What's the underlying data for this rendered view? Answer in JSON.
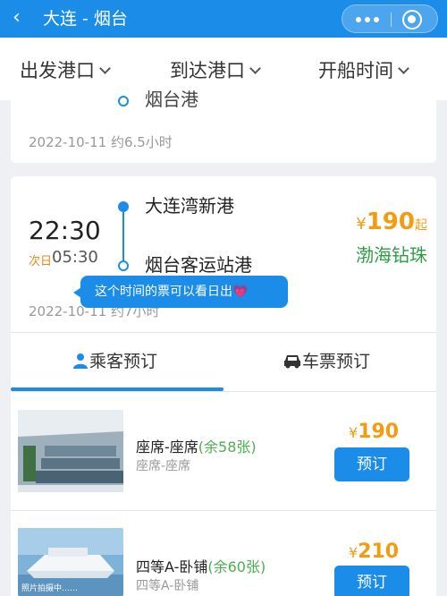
{
  "nav": {
    "back_icon": "‹",
    "title": "大连 - 烟台"
  },
  "filters": [
    {
      "label": "出发港口"
    },
    {
      "label": "到达港口"
    },
    {
      "label": "开船时间"
    }
  ],
  "card_prev": {
    "arrival_station": "烟台港",
    "date_duration": "2022-10-11 约6.5小时"
  },
  "card_main": {
    "depart_time": "22:30",
    "arrive_flag": "次日",
    "arrive_time": "05:30",
    "depart_station": "大连湾新港",
    "arrive_station": "烟台客运站港",
    "price_currency": "¥",
    "price": "190",
    "price_suffix": "起",
    "ship_name": "渤海钻珠",
    "date_duration": "2022-10-11 约7小时"
  },
  "tooltip": {
    "text": "这个时间的票可以看日出",
    "heart": "💗"
  },
  "tabs": [
    {
      "label": "乘客预订"
    },
    {
      "label": "车票预订"
    }
  ],
  "tickets": [
    {
      "name": "座席-座席",
      "remain": "(余58张)",
      "sub": "座席-座席",
      "currency": "¥",
      "price": "190",
      "button": "预订"
    },
    {
      "name": "四等A-卧铺",
      "remain": "(余60张)",
      "sub": "四等A-卧铺",
      "currency": "¥",
      "price": "210",
      "button": "预订",
      "photo_caption": "照片拍摄中……"
    }
  ],
  "colors": {
    "primary": "#1b8ce8",
    "price": "#f39c12",
    "ship": "#2e9e44",
    "remain": "#4caf50",
    "next_day": "#e8871e"
  }
}
